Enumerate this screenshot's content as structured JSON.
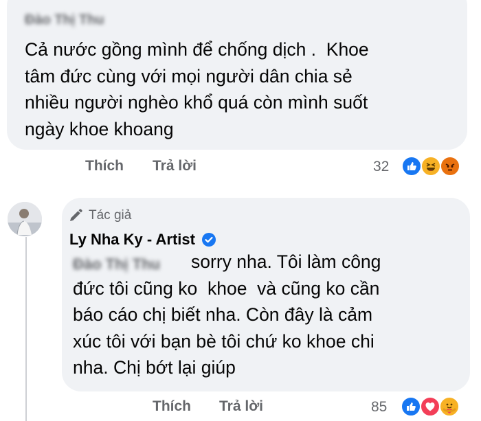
{
  "comment1": {
    "author": "Đào Thị Thu",
    "text": "Cả nước gồng mình để chống dịch .  Khoe\ntâm đức cùng với mọi người dân chia sẻ\nnhiều người nghèo khổ quá còn mình suốt\nngày khoe khoang",
    "like_label": "Thích",
    "reply_label": "Trả lời",
    "reaction_count": "32",
    "reactions": [
      "like-icon",
      "haha-icon",
      "angry-icon"
    ]
  },
  "reply": {
    "badge_label": "Tác giả",
    "author": "Ly Nha Ky - Artist",
    "verified": true,
    "mention": "Đào Thị Thu",
    "text": "sorry nha. Tôi làm công\nđức tôi cũng ko  khoe  và cũng ko cần\nbáo cáo chị biết nha. Còn đây là cảm\nxúc tôi với bạn bè tôi chứ ko khoe chi\nnha. Chị bớt lại giúp",
    "like_label": "Thích",
    "reply_label": "Trả lời",
    "reaction_count": "85",
    "reactions": [
      "like-icon",
      "love-icon",
      "care-icon"
    ]
  },
  "colors": {
    "bubble": "#f0f2f5",
    "secondary_text": "#65676b",
    "like_blue": "#1877f2",
    "love_red": "#f33e58",
    "reaction_yellow": "#f7b125"
  }
}
